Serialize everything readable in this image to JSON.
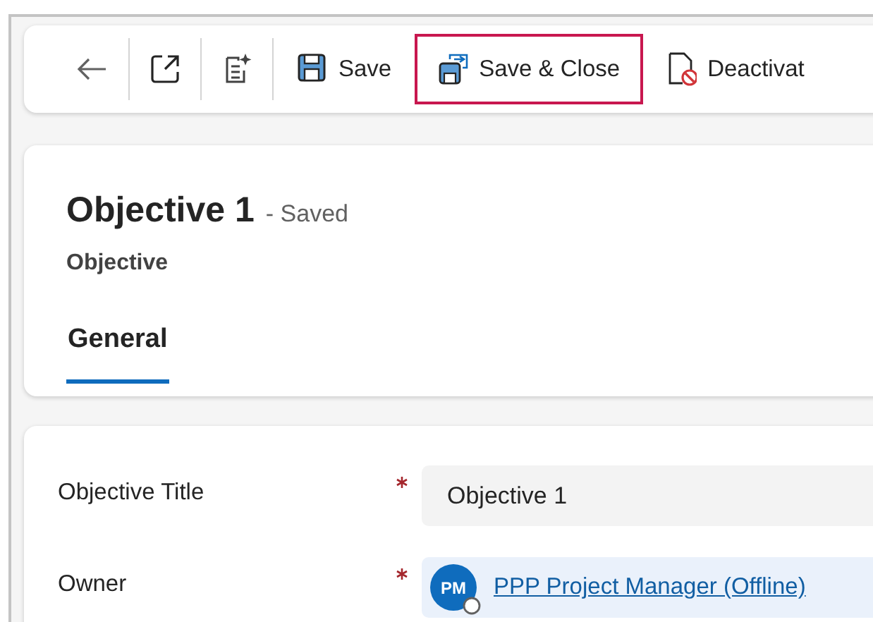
{
  "toolbar": {
    "buttons": [
      {
        "kind": "save",
        "label": "Save",
        "highlighted": false
      },
      {
        "kind": "saveclose",
        "label": "Save & Close",
        "highlighted": true
      },
      {
        "kind": "deactivate",
        "label": "Deactivat",
        "highlighted": false
      }
    ]
  },
  "header": {
    "title": "Objective 1",
    "status": "- Saved",
    "entity": "Objective",
    "tabs": [
      {
        "label": "General",
        "selected": true
      }
    ]
  },
  "fields": [
    {
      "kind": "text",
      "label": "Objective Title",
      "required": true,
      "value": "Objective 1"
    },
    {
      "kind": "lookup",
      "label": "Owner",
      "required": true,
      "initials": "PM",
      "value": "PPP Project Manager (Offline)"
    }
  ]
}
